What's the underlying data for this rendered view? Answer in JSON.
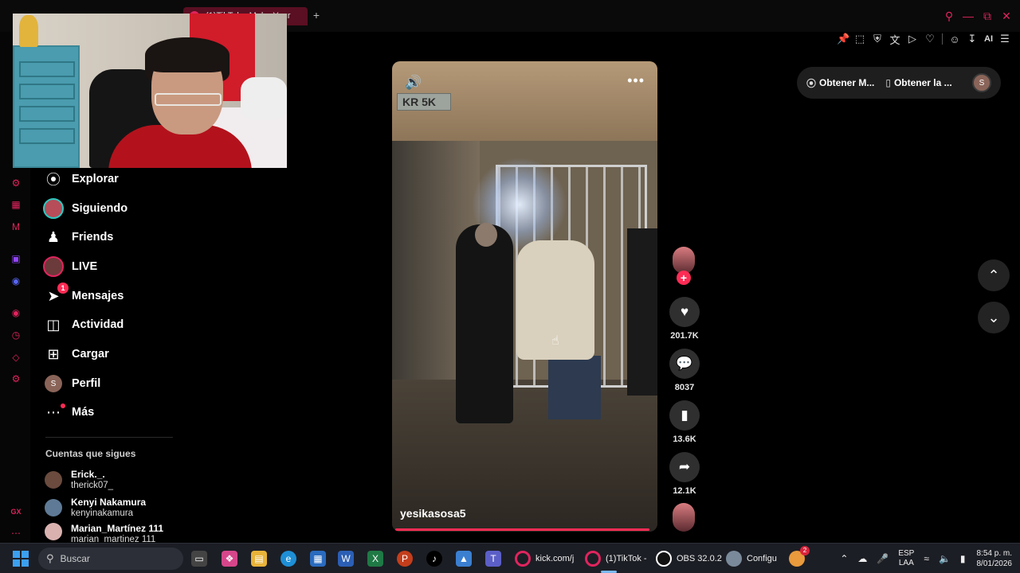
{
  "browser": {
    "active_tab_label": "(1)TikTok - Make Your",
    "new_tab_symbol": "+",
    "toolbar_ai_label": "AI"
  },
  "nav": {
    "items": [
      {
        "label": "Explorar",
        "icon": "compass-icon"
      },
      {
        "label": "Siguiendo",
        "icon": "avatar"
      },
      {
        "label": "Friends",
        "icon": "friends-icon"
      },
      {
        "label": "LIVE",
        "icon": "live-avatar"
      },
      {
        "label": "Mensajes",
        "icon": "send-icon",
        "badge": "1"
      },
      {
        "label": "Actividad",
        "icon": "activity-icon"
      },
      {
        "label": "Cargar",
        "icon": "upload-icon"
      },
      {
        "label": "Perfil",
        "icon": "profile-avatar",
        "avatar_letter": "S"
      },
      {
        "label": "Más",
        "icon": "more-icon"
      }
    ],
    "following_title": "Cuentas que sigues",
    "following": [
      {
        "name": "Erick._.",
        "handle": "therick07_"
      },
      {
        "name": "Kenyi Nakamura",
        "handle": "kenyinakamura"
      },
      {
        "name": "Marian_Martínez 111",
        "handle": "marian_martinez 111"
      }
    ]
  },
  "video": {
    "street_sign": "KR 5K",
    "username": "yesikasosa5",
    "more_symbol": "•••",
    "likes": "201.7K",
    "comments": "8037",
    "saves": "13.6K",
    "shares": "12.1K",
    "progress": 0.98
  },
  "right": {
    "get_app_1": "Obtener M...",
    "get_app_2": "Obtener la ...",
    "me_letter": "S"
  },
  "taskbar": {
    "search_placeholder": "Buscar",
    "apps": [
      {
        "label": "kick.com/j",
        "color": "#e0245e"
      },
      {
        "label": "(1)TikTok -",
        "color": "#e0245e"
      },
      {
        "label": "OBS 32.0.2",
        "color": "#ffffff"
      },
      {
        "label": "Configu",
        "color": "#7a8a9a"
      }
    ],
    "notif_badge": "2",
    "lang_1": "ESP",
    "lang_2": "LAA",
    "time": "8:54 p. m.",
    "date": "8/01/2026"
  },
  "colors": {
    "accent": "#fe2c55",
    "gx_accent": "#e0245e"
  }
}
